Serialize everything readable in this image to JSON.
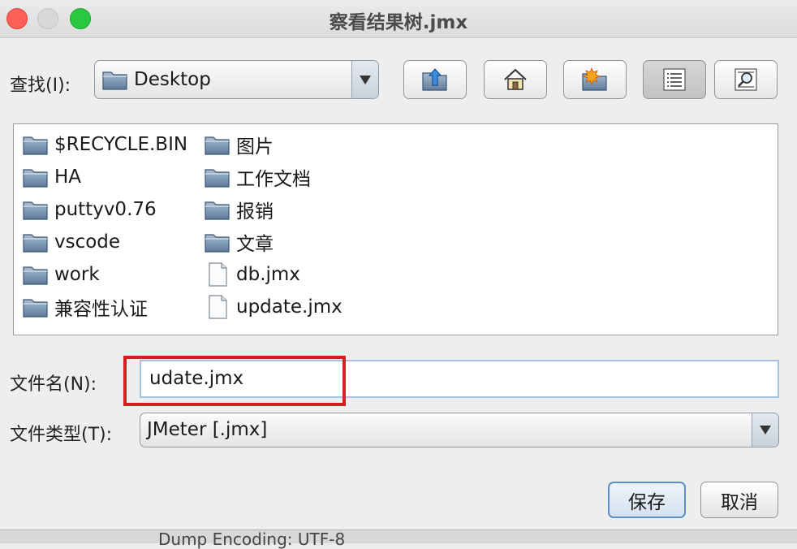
{
  "window": {
    "title": "察看结果树.jmx"
  },
  "look_in": {
    "label": "查找(I):",
    "value": "Desktop"
  },
  "toolbar": {
    "buttons": [
      {
        "name": "up-one-level",
        "icon": "folder-up-icon"
      },
      {
        "name": "home",
        "icon": "home-icon"
      },
      {
        "name": "new-folder",
        "icon": "new-folder-icon"
      },
      {
        "name": "list-view",
        "icon": "list-view-icon",
        "active": true
      },
      {
        "name": "details-view",
        "icon": "details-view-icon"
      }
    ]
  },
  "files": {
    "column1": [
      {
        "name": "$RECYCLE.BIN",
        "type": "folder"
      },
      {
        "name": "HA",
        "type": "folder"
      },
      {
        "name": "puttyv0.76",
        "type": "folder"
      },
      {
        "name": "vscode",
        "type": "folder"
      },
      {
        "name": "work",
        "type": "folder"
      },
      {
        "name": "兼容性认证",
        "type": "folder"
      }
    ],
    "column2": [
      {
        "name": "图片",
        "type": "folder"
      },
      {
        "name": "工作文档",
        "type": "folder"
      },
      {
        "name": "报销",
        "type": "folder"
      },
      {
        "name": "文章",
        "type": "folder"
      },
      {
        "name": "db.jmx",
        "type": "file"
      },
      {
        "name": "update.jmx",
        "type": "file"
      }
    ]
  },
  "filename": {
    "label": "文件名(N):",
    "value": "udate.jmx"
  },
  "filetype": {
    "label": "文件类型(T):",
    "value": "JMeter [.jmx]"
  },
  "actions": {
    "save_label": "保存",
    "cancel_label": "取消"
  },
  "behind_window": {
    "text": "Dump Encoding: UTF-8"
  },
  "colors": {
    "highlight": "#d81e22",
    "close": "#fe5f57",
    "maximize": "#28c840"
  }
}
